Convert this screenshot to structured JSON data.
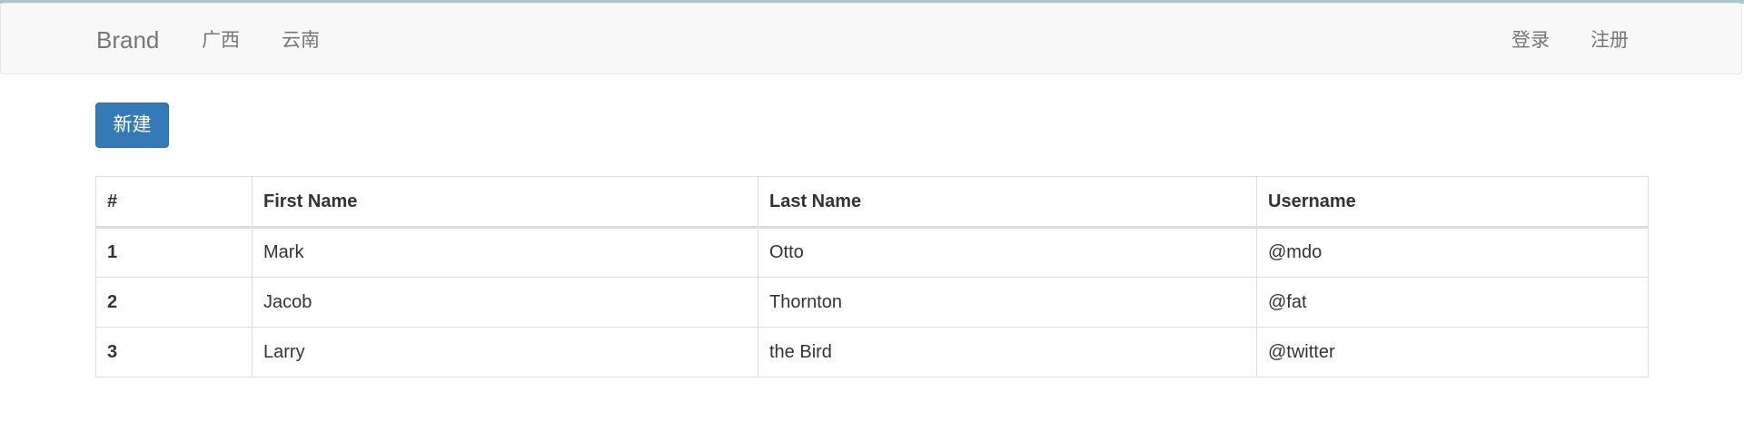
{
  "navbar": {
    "brand": "Brand",
    "left_links": [
      "广西",
      "云南"
    ],
    "right_links": [
      "登录",
      "注册"
    ]
  },
  "toolbar": {
    "new_label": "新建"
  },
  "table": {
    "headers": [
      "#",
      "First Name",
      "Last Name",
      "Username"
    ],
    "rows": [
      {
        "num": "1",
        "first": "Mark",
        "last": "Otto",
        "username": "@mdo"
      },
      {
        "num": "2",
        "first": "Jacob",
        "last": "Thornton",
        "username": "@fat"
      },
      {
        "num": "3",
        "first": "Larry",
        "last": "the Bird",
        "username": "@twitter"
      }
    ]
  }
}
